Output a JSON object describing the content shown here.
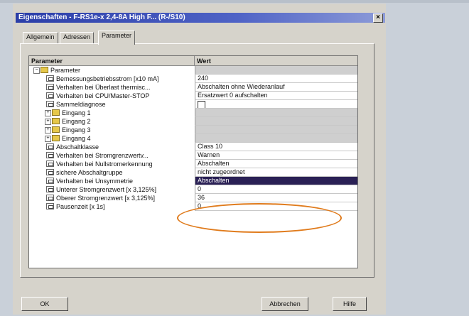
{
  "window": {
    "title": "Eigenschaften - F-RS1e-x 2,4-8A High F... (R-/S10)"
  },
  "tabs": [
    {
      "label": "Allgemein"
    },
    {
      "label": "Adressen"
    },
    {
      "label": "Parameter"
    }
  ],
  "grid": {
    "col_param": "Parameter",
    "col_value": "Wert",
    "rows": [
      {
        "label": "Parameter",
        "value": "",
        "type": "folder",
        "expander": "−"
      },
      {
        "label": "Bemessungsbetriebsstrom [x10 mA]",
        "value": "240",
        "type": "param"
      },
      {
        "label": "Verhalten bei Überlast thermisc...",
        "value": "Abschalten ohne Wiederanlauf",
        "type": "param"
      },
      {
        "label": "Verhalten bei CPU/Master-STOP",
        "value": "Ersatzwert 0 aufschalten",
        "type": "param"
      },
      {
        "label": "Sammeldiagnose",
        "value": "",
        "type": "param",
        "checkbox": true
      },
      {
        "label": "Eingang 1",
        "value": "",
        "type": "folder",
        "expander": "+"
      },
      {
        "label": "Eingang 2",
        "value": "",
        "type": "folder",
        "expander": "+"
      },
      {
        "label": "Eingang 3",
        "value": "",
        "type": "folder",
        "expander": "+"
      },
      {
        "label": "Eingang 4",
        "value": "",
        "type": "folder",
        "expander": "+"
      },
      {
        "label": "Abschaltklasse",
        "value": "Class 10",
        "type": "param"
      },
      {
        "label": "Verhalten bei Stromgrenzwertv...",
        "value": "Warnen",
        "type": "param"
      },
      {
        "label": "Verhalten bei Nullstromerkennung",
        "value": "Abschalten",
        "type": "param"
      },
      {
        "label": "sichere Abschaltgruppe",
        "value": "nicht zugeordnet",
        "type": "param"
      },
      {
        "label": "Verhalten bei Unsymmetrie",
        "value": "Abschalten",
        "type": "param",
        "selected": true
      },
      {
        "label": "Unterer Stromgrenzwert [x 3,125%]",
        "value": "0",
        "type": "param"
      },
      {
        "label": "Oberer Stromgrenzwert [x 3,125%]",
        "value": "36",
        "type": "param"
      },
      {
        "label": "Pausenzeit [x 1s]",
        "value": "0",
        "type": "param"
      }
    ]
  },
  "buttons": {
    "ok": "OK",
    "cancel": "Abbrechen",
    "help": "Hilfe"
  },
  "colors": {
    "highlight_ellipse": "#e07b1c",
    "selection": "#2a2055",
    "titlebar": "#2b3ea8"
  }
}
